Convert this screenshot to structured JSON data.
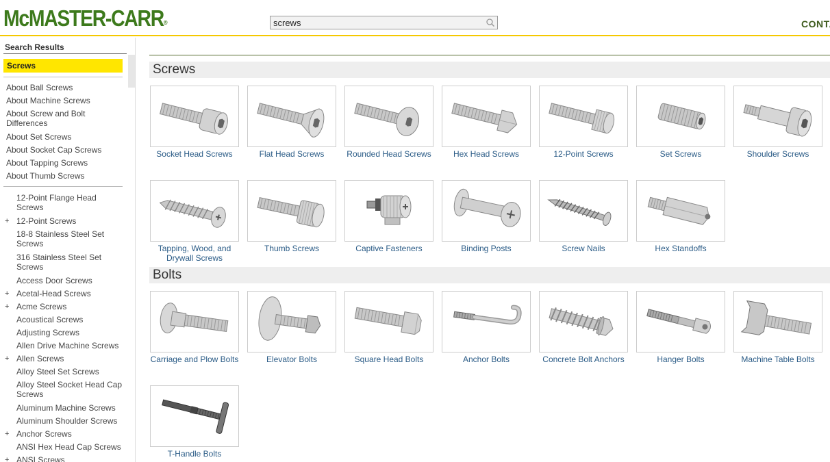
{
  "header": {
    "logo_text": "McMASTER-CARR",
    "logo_mark": "®",
    "search_value": "screws",
    "contact_label": "CONTACT US"
  },
  "sidebar": {
    "heading": "Search Results",
    "active": "Screws",
    "about_links": [
      "About Ball Screws",
      "About Machine Screws",
      "About Screw and Bolt Differences",
      "About Set Screws",
      "About Socket Cap Screws",
      "About Tapping Screws",
      "About Thumb Screws"
    ],
    "categories": [
      {
        "label": "12-Point Flange Head Screws",
        "plus": ""
      },
      {
        "label": "12-Point Screws",
        "plus": "+"
      },
      {
        "label": "18-8 Stainless Steel Set Screws",
        "plus": ""
      },
      {
        "label": "316 Stainless Steel Set Screws",
        "plus": ""
      },
      {
        "label": "Access Door Screws",
        "plus": ""
      },
      {
        "label": "Acetal-Head Screws",
        "plus": "+"
      },
      {
        "label": "Acme Screws",
        "plus": "+"
      },
      {
        "label": "Acoustical Screws",
        "plus": ""
      },
      {
        "label": "Adjusting Screws",
        "plus": ""
      },
      {
        "label": "Allen Drive Machine Screws",
        "plus": ""
      },
      {
        "label": "Allen Screws",
        "plus": "+"
      },
      {
        "label": "Alloy Steel Set Screws",
        "plus": ""
      },
      {
        "label": "Alloy Steel Socket Head Cap Screws",
        "plus": ""
      },
      {
        "label": "Aluminum Machine Screws",
        "plus": ""
      },
      {
        "label": "Aluminum Shoulder Screws",
        "plus": ""
      },
      {
        "label": "Anchor Screws",
        "plus": "+"
      },
      {
        "label": "ANSI Hex Head Cap Screws",
        "plus": ""
      },
      {
        "label": "ANSI Screws",
        "plus": "+"
      }
    ]
  },
  "main": {
    "sections": [
      {
        "title": "Screws",
        "items": [
          {
            "label": "Socket Head Screws",
            "icon": "socket-head-screw-icon"
          },
          {
            "label": "Flat Head Screws",
            "icon": "flat-head-screw-icon"
          },
          {
            "label": "Rounded Head Screws",
            "icon": "rounded-head-screw-icon"
          },
          {
            "label": "Hex Head Screws",
            "icon": "hex-head-screw-icon"
          },
          {
            "label": "12-Point Screws",
            "icon": "12-point-screw-icon"
          },
          {
            "label": "Set Screws",
            "icon": "set-screw-icon"
          },
          {
            "label": "Shoulder Screws",
            "icon": "shoulder-screw-icon"
          },
          {
            "label": "Tapping, Wood, and Drywall Screws",
            "icon": "tapping-screw-icon"
          },
          {
            "label": "Thumb Screws",
            "icon": "thumb-screw-icon"
          },
          {
            "label": "Captive Fasteners",
            "icon": "captive-fastener-icon"
          },
          {
            "label": "Binding Posts",
            "icon": "binding-post-icon"
          },
          {
            "label": "Screw Nails",
            "icon": "screw-nail-icon"
          },
          {
            "label": "Hex Standoffs",
            "icon": "hex-standoff-icon"
          }
        ]
      },
      {
        "title": "Bolts",
        "items": [
          {
            "label": "Carriage and Plow Bolts",
            "icon": "carriage-bolt-icon"
          },
          {
            "label": "Elevator Bolts",
            "icon": "elevator-bolt-icon"
          },
          {
            "label": "Square Head Bolts",
            "icon": "square-head-bolt-icon"
          },
          {
            "label": "Anchor Bolts",
            "icon": "anchor-bolt-icon"
          },
          {
            "label": "Concrete Bolt Anchors",
            "icon": "concrete-anchor-icon"
          },
          {
            "label": "Hanger Bolts",
            "icon": "hanger-bolt-icon"
          },
          {
            "label": "Machine Table Bolts",
            "icon": "machine-table-bolt-icon"
          },
          {
            "label": "T-Handle Bolts",
            "icon": "t-handle-bolt-icon"
          }
        ]
      }
    ]
  },
  "colors": {
    "brand_green": "#3d7a1c",
    "accent_yellow": "#ffe600",
    "link_blue": "#2a5b86"
  }
}
